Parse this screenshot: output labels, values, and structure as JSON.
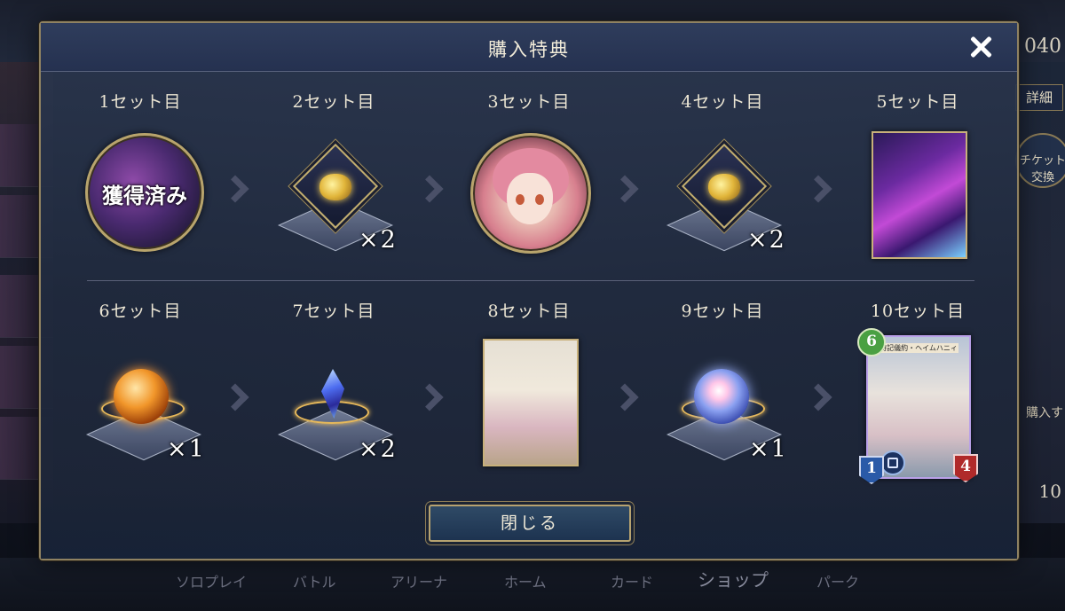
{
  "background": {
    "top_number": "040",
    "detail_button": "詳細",
    "ticket_button": "チケット交換",
    "buy_label": "購入す",
    "right_number": "10",
    "nav": [
      "ソロプレイ",
      "バトル",
      "アリーナ",
      "ホーム",
      "カード",
      "ショップ",
      "パーク"
    ]
  },
  "modal": {
    "title": "購入特典",
    "close_button": "閉じる"
  },
  "rewards": [
    {
      "label": "1セット目",
      "kind": "acquired-medallion",
      "overlay": "獲得済み"
    },
    {
      "label": "2セット目",
      "kind": "emblem",
      "quantity": "×2"
    },
    {
      "label": "3セット目",
      "kind": "character-medallion"
    },
    {
      "label": "4セット目",
      "kind": "emblem",
      "quantity": "×2"
    },
    {
      "label": "5セット目",
      "kind": "card-art"
    },
    {
      "label": "6セット目",
      "kind": "orange-orb",
      "quantity": "×1"
    },
    {
      "label": "7セット目",
      "kind": "crystal",
      "quantity": "×2"
    },
    {
      "label": "8セット目",
      "kind": "card-art"
    },
    {
      "label": "9セット目",
      "kind": "blue-orb",
      "quantity": "×1"
    },
    {
      "label": "10セット目",
      "kind": "card",
      "card": {
        "cost": "6",
        "attack": "1",
        "defense": "4",
        "name": "特記儀約・ヘイムハニィ"
      }
    }
  ],
  "colors": {
    "frame_gold": "#b8a46c",
    "panel_blue": "#243049",
    "text_cream": "#ece6d4"
  }
}
